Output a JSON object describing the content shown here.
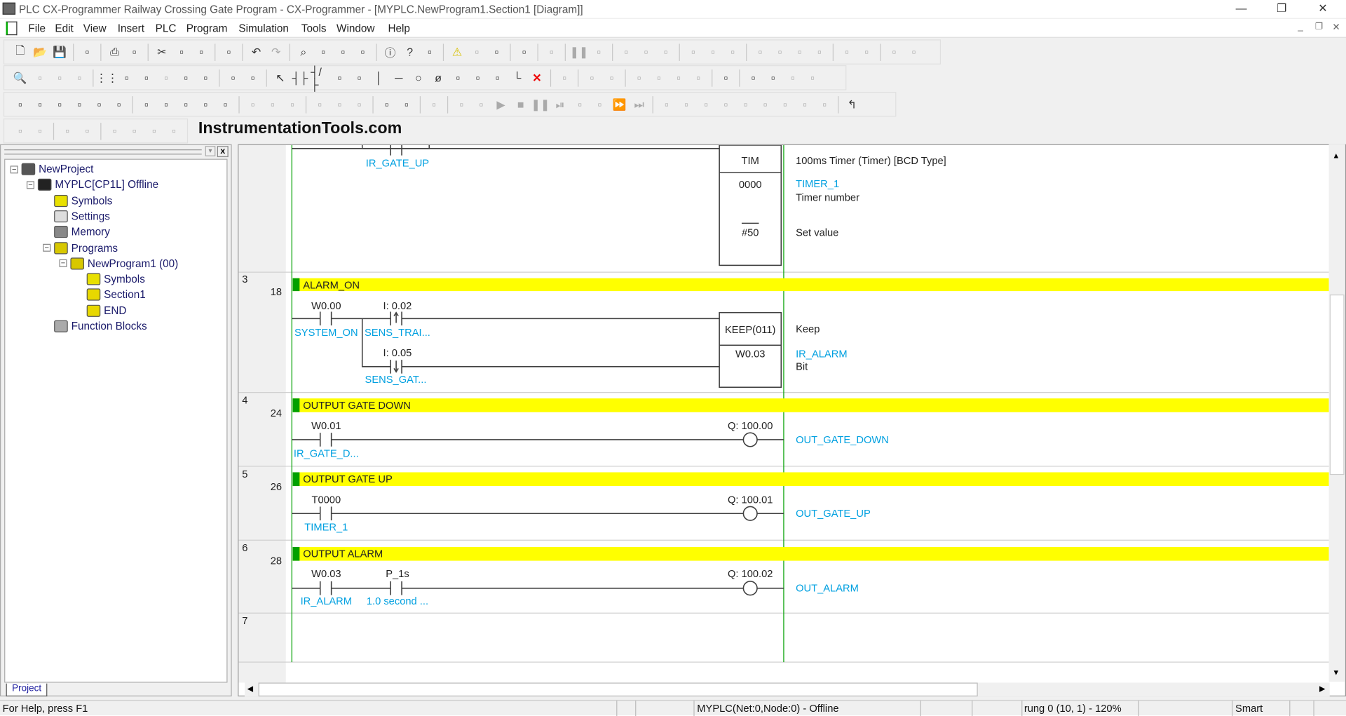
{
  "window": {
    "title": "PLC CX-Programmer Railway Crossing Gate Program - CX-Programmer - [MYPLC.NewProgram1.Section1 [Diagram]]",
    "controls": [
      "minimize",
      "restore",
      "close"
    ]
  },
  "menu": [
    "File",
    "Edit",
    "View",
    "Insert",
    "PLC",
    "Program",
    "Simulation",
    "Tools",
    "Window",
    "Help"
  ],
  "toolbars": [
    [
      "new-icon",
      "open-icon",
      "save-icon",
      "|",
      "print-preview-icon",
      "|",
      "print-icon",
      "preview-icon",
      "|",
      "cut-icon",
      "copy-icon",
      "paste-icon",
      "|",
      "paste-special-icon",
      "|",
      "undo-icon",
      "redo-icon",
      "|",
      "find-icon",
      "replace-icon",
      "cross-ref-icon",
      "address-ref-icon",
      "|",
      "info-icon",
      "help-icon",
      "context-help-icon",
      "|",
      "warning-icon",
      "online-warning-icon",
      "find-warning-icon",
      "|",
      "compile-icon",
      "|",
      "program-check-icon",
      "|",
      "pause-icon",
      "stop-icon",
      "|",
      "transfer-icon",
      "transfer-to-icon",
      "transfer-from-icon",
      "|",
      "compare-icon",
      "online-edit-icon",
      "cancel-edit-icon",
      "|",
      "monitor-icon",
      "monitor2-icon",
      "monitor3-icon",
      "monitor4-icon",
      "|",
      "force-icon",
      "differential-icon",
      "|",
      "io-table-icon",
      "setup-icon"
    ],
    [
      "zoom-icon",
      "zoom-in-icon",
      "zoom-out-icon",
      "zoom-fit-icon",
      "|",
      "grid-icon",
      "symbol-comment-icon",
      "rung-comment-icon",
      "monitor-io-icon",
      "io-comment-icon",
      "tree-icon",
      "|",
      "sma-icon",
      "ci-icon",
      "|",
      "select-icon",
      "contact-no-icon",
      "contact-nc-icon",
      "contact-or-icon",
      "contact-or-nc-icon",
      "vertical-icon",
      "horizontal-icon",
      "coil-icon",
      "coil-nc-icon",
      "instruction-icon",
      "pt-instruction-icon",
      "fb-icon",
      "corner-icon",
      "delete-icon",
      "|",
      "online-edit2-icon",
      "|",
      "transfer-program-icon",
      "transfer-all-icon",
      "|",
      "edit-icon",
      "cancel-icon",
      "confirm-icon",
      "reset-icon",
      "|",
      "watch-icon",
      "|",
      "data-trace-icon",
      "time-chart-icon",
      "close-window-icon",
      "check-icon"
    ],
    [
      "project-window-icon",
      "output-window-icon",
      "watch-window-icon",
      "address-window-icon",
      "properties-icon",
      "cross-ref-window-icon",
      "|",
      "symbols-view-icon",
      "local-symbols-icon",
      "ladder-view-icon",
      "mnemonics-icon",
      "memory-icon",
      "|",
      "decimal-icon",
      "signed-decimal-icon",
      "hex-icon",
      "|",
      "upload-icon",
      "download-icon",
      "compare2-icon",
      "|",
      "simulator-icon",
      "debug-icon",
      "|",
      "break-icon",
      "|",
      "run-icon",
      "monitor-mode-icon",
      "play-icon",
      "stop2-icon",
      "pause2-icon",
      "step-icon",
      "step-in-icon",
      "step-out-icon",
      "continuous-icon",
      "scan-icon",
      "|",
      "block1-icon",
      "block2-icon",
      "block3-icon",
      "block4-icon",
      "block5-icon",
      "block6-icon",
      "block7-icon",
      "block8-icon",
      "block9-icon",
      "|",
      "return-icon"
    ],
    [
      "indent-left-icon",
      "indent-right-icon",
      "|",
      "list-icon",
      "list2-icon",
      "|",
      "tool1-icon",
      "tool2-icon",
      "tool3-icon",
      "tool4-icon"
    ]
  ],
  "brand": "InstrumentationTools.com",
  "project_tree": {
    "tab": "Project",
    "items": [
      {
        "label": "NewProject",
        "icon": "network-icon",
        "level": 0,
        "exp": "−"
      },
      {
        "label": "MYPLC[CP1L] Offline",
        "icon": "plc-icon",
        "level": 1,
        "exp": "−"
      },
      {
        "label": "Symbols",
        "icon": "symbols-icon",
        "level": 2
      },
      {
        "label": "Settings",
        "icon": "settings-icon",
        "level": 2
      },
      {
        "label": "Memory",
        "icon": "memory-icon",
        "level": 2
      },
      {
        "label": "Programs",
        "icon": "programs-icon",
        "level": 2,
        "exp": "−"
      },
      {
        "label": "NewProgram1 (00)",
        "icon": "program-icon",
        "level": 3,
        "exp": "−"
      },
      {
        "label": "Symbols",
        "icon": "symbols-icon",
        "level": 4
      },
      {
        "label": "Section1",
        "icon": "section-icon",
        "level": 4
      },
      {
        "label": "END",
        "icon": "section-icon",
        "level": 4
      },
      {
        "label": "Function Blocks",
        "icon": "function-blocks-icon",
        "level": 2
      }
    ]
  },
  "ladder": {
    "colors": {
      "comment_bg": "#ffff00",
      "rail": "#00a000",
      "symbol": "#00a0e0",
      "line": "#404040"
    },
    "rung2": {
      "contact_symbol": "IR_GATE_UP",
      "instr": "TIM",
      "operand1": "0000",
      "operand2": "#50",
      "desc_title": "100ms Timer (Timer) [BCD Type]",
      "op1_symbol": "TIMER_1",
      "op1_desc": "Timer number",
      "op2_desc": "Set value"
    },
    "rung3": {
      "number": "3",
      "step": "18",
      "comment": "ALARM_ON",
      "c1_addr": "W0.00",
      "c1_sym": "SYSTEM_ON",
      "c2_addr": "I: 0.02",
      "c2_sym": "SENS_TRAI...",
      "c3_addr": "I: 0.05",
      "c3_sym": "SENS_GAT...",
      "instr": "KEEP(011)",
      "operand": "W0.03",
      "desc_title": "Keep",
      "op_symbol": "IR_ALARM",
      "op_desc": "Bit"
    },
    "rung4": {
      "number": "4",
      "step": "24",
      "comment": "OUTPUT GATE DOWN",
      "c1_addr": "W0.01",
      "c1_sym": "IR_GATE_D...",
      "coil_addr": "Q: 100.00",
      "coil_sym": "OUT_GATE_DOWN"
    },
    "rung5": {
      "number": "5",
      "step": "26",
      "comment": "OUTPUT GATE UP",
      "c1_addr": "T0000",
      "c1_sym": "TIMER_1",
      "coil_addr": "Q: 100.01",
      "coil_sym": "OUT_GATE_UP"
    },
    "rung6": {
      "number": "6",
      "step": "28",
      "comment": "OUTPUT ALARM",
      "c1_addr": "W0.03",
      "c1_sym": "IR_ALARM",
      "c2_addr": "P_1s",
      "c2_sym": "1.0 second ...",
      "coil_addr": "Q: 100.02",
      "coil_sym": "OUT_ALARM"
    },
    "rung7": {
      "number": "7"
    }
  },
  "status": {
    "help": "For Help, press F1",
    "connection": "MYPLC(Net:0,Node:0) - Offline",
    "position": "rung 0 (10, 1)  - 120%",
    "mode": "Smart"
  }
}
